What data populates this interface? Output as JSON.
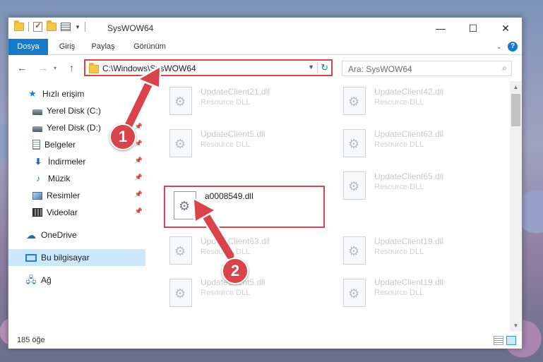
{
  "window": {
    "title": "SysWOW64",
    "controls": {
      "minimize": "—",
      "maximize": "☐",
      "close": "✕"
    }
  },
  "ribbon": {
    "tabs": [
      "Dosya",
      "Giriş",
      "Paylaş",
      "Görünüm"
    ],
    "help": "?",
    "accent_color": "#1979ca"
  },
  "address": {
    "path": "C:\\Windows\\SysWOW64",
    "search_placeholder": "Ara: SysWOW64"
  },
  "nav": {
    "items": [
      {
        "label": "Hızlı erişim",
        "icon": "star-icon",
        "pinned": false
      },
      {
        "label": "Yerel Disk (C:)",
        "icon": "drive-icon",
        "pinned": true
      },
      {
        "label": "Yerel Disk (D:)",
        "icon": "drive-icon",
        "pinned": true
      },
      {
        "label": "Belgeler",
        "icon": "document-icon",
        "pinned": true
      },
      {
        "label": "İndirmeler",
        "icon": "download-icon",
        "pinned": true
      },
      {
        "label": "Müzik",
        "icon": "music-icon",
        "pinned": true
      },
      {
        "label": "Resimler",
        "icon": "pictures-icon",
        "pinned": true
      },
      {
        "label": "Videolar",
        "icon": "video-icon",
        "pinned": true
      },
      {
        "label": "OneDrive",
        "icon": "cloud-icon",
        "pinned": false
      },
      {
        "label": "Bu bilgisayar",
        "icon": "computer-icon",
        "pinned": false,
        "selected": true
      },
      {
        "label": "Ağ",
        "icon": "network-icon",
        "pinned": false
      }
    ]
  },
  "files": {
    "left": [
      {
        "name": "UpdateClient21.dll",
        "type": "Resource DLL"
      },
      {
        "name": "UpdateClient5.dll",
        "type": "Resource DLL"
      },
      {
        "name": "a0008549.dll",
        "type": "",
        "highlighted": true
      },
      {
        "name": "UpdateClient63.dll",
        "type": "Resource DLL"
      },
      {
        "name": "UpdateClient5.dll",
        "type": "Resource DLL"
      }
    ],
    "right": [
      {
        "name": "UpdateClient42.dll",
        "type": "Resource DLL"
      },
      {
        "name": "UpdateClient63.dll",
        "type": "Resource DLL"
      },
      {
        "name": "UpdateClient65.dll",
        "type": "Resource DLL"
      },
      {
        "name": "UpdateClient19.dll",
        "type": "Resource DLL"
      },
      {
        "name": "UpdateClient19.dll",
        "type": "Resource DLL"
      }
    ]
  },
  "status": {
    "count": "185 öğe"
  },
  "annotations": {
    "step1": "1",
    "step2": "2",
    "color": "#d9444b"
  }
}
